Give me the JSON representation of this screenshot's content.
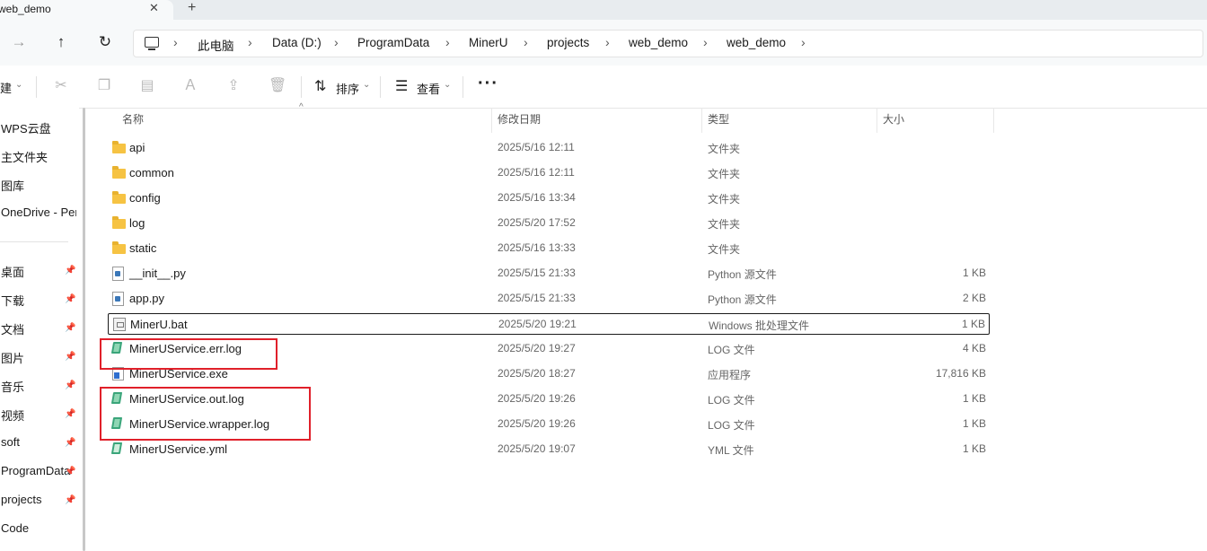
{
  "tab": {
    "title": "web_demo",
    "close": "✕",
    "new": "+"
  },
  "nav": {
    "forward": "→",
    "up": "↑",
    "refresh": "↻"
  },
  "breadcrumb": [
    "此电脑",
    "Data (D:)",
    "ProgramData",
    "MinerU",
    "projects",
    "web_demo",
    "web_demo"
  ],
  "breadcrumb_sep": "›",
  "toolbar": {
    "new_label": "建",
    "sort_label": "排序",
    "view_label": "查看",
    "more": "···",
    "caret": "⌄"
  },
  "sidebar": {
    "top_items": [
      "WPS云盘",
      "主文件夹",
      "图库",
      "OneDrive - Per"
    ],
    "pinned_items": [
      "桌面",
      "下载",
      "文档",
      "图片",
      "音乐",
      "视频",
      "soft",
      "ProgramData",
      "projects"
    ],
    "bottom_items": [
      "Code"
    ],
    "pin_glyph": "📌"
  },
  "columns": {
    "name": "名称",
    "date": "修改日期",
    "type": "类型",
    "size": "大小",
    "sort_caret": "^"
  },
  "files": [
    {
      "name": "api",
      "date": "2025/5/16 12:11",
      "type": "文件夹",
      "size": "",
      "icon": "folder-icon"
    },
    {
      "name": "common",
      "date": "2025/5/16 12:11",
      "type": "文件夹",
      "size": "",
      "icon": "folder-icon"
    },
    {
      "name": "config",
      "date": "2025/5/16 13:34",
      "type": "文件夹",
      "size": "",
      "icon": "folder-icon"
    },
    {
      "name": "log",
      "date": "2025/5/20 17:52",
      "type": "文件夹",
      "size": "",
      "icon": "folder-icon"
    },
    {
      "name": "static",
      "date": "2025/5/16 13:33",
      "type": "文件夹",
      "size": "",
      "icon": "folder-icon"
    },
    {
      "name": "__init__.py",
      "date": "2025/5/15 21:33",
      "type": "Python 源文件",
      "size": "1 KB",
      "icon": "python-file-icon"
    },
    {
      "name": "app.py",
      "date": "2025/5/15 21:33",
      "type": "Python 源文件",
      "size": "2 KB",
      "icon": "python-file-icon"
    },
    {
      "name": "MinerU.bat",
      "date": "2025/5/20 19:21",
      "type": "Windows 批处理文件",
      "size": "1 KB",
      "icon": "batch-file-icon"
    },
    {
      "name": "MinerUService.err.log",
      "date": "2025/5/20 19:27",
      "type": "LOG 文件",
      "size": "4 KB",
      "icon": "log-file-icon"
    },
    {
      "name": "MinerUService.exe",
      "date": "2025/5/20 18:27",
      "type": "应用程序",
      "size": "17,816 KB",
      "icon": "exe-file-icon"
    },
    {
      "name": "MinerUService.out.log",
      "date": "2025/5/20 19:26",
      "type": "LOG 文件",
      "size": "1 KB",
      "icon": "log-file-icon"
    },
    {
      "name": "MinerUService.wrapper.log",
      "date": "2025/5/20 19:26",
      "type": "LOG 文件",
      "size": "1 KB",
      "icon": "log-file-icon"
    },
    {
      "name": "MinerUService.yml",
      "date": "2025/5/20 19:07",
      "type": "YML 文件",
      "size": "1 KB",
      "icon": "yml-file-icon"
    }
  ],
  "selected_file": "MinerU.bat",
  "annotation_color": "#e0202a"
}
